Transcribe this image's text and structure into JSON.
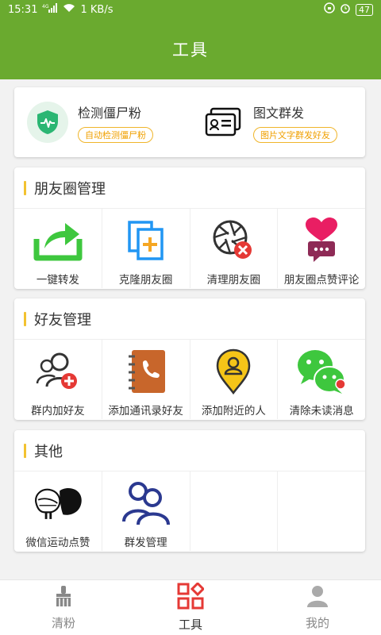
{
  "status_bar": {
    "time": "15:31",
    "network": "4G",
    "speed": "1 KB/s",
    "battery": "47"
  },
  "header": {
    "title": "工具"
  },
  "features": [
    {
      "title": "检测僵尸粉",
      "subtitle": "自动检测僵尸粉"
    },
    {
      "title": "图文群发",
      "subtitle": "图片文字群发好友"
    }
  ],
  "sections": {
    "moments": {
      "title": "朋友圈管理",
      "items": [
        "一键转发",
        "克隆朋友圈",
        "清理朋友圈",
        "朋友圈点赞评论"
      ]
    },
    "friends": {
      "title": "好友管理",
      "items": [
        "群内加好友",
        "添加通讯录好友",
        "添加附近的人",
        "清除未读消息"
      ]
    },
    "other": {
      "title": "其他",
      "items": [
        "微信运动点赞",
        "群发管理"
      ]
    }
  },
  "tabbar": {
    "tabs": [
      "清粉",
      "工具",
      "我的"
    ],
    "active": "工具"
  },
  "colors": {
    "brand_green": "#6aaa2f",
    "accent_orange": "#f0a000",
    "active_red": "#e53935"
  }
}
